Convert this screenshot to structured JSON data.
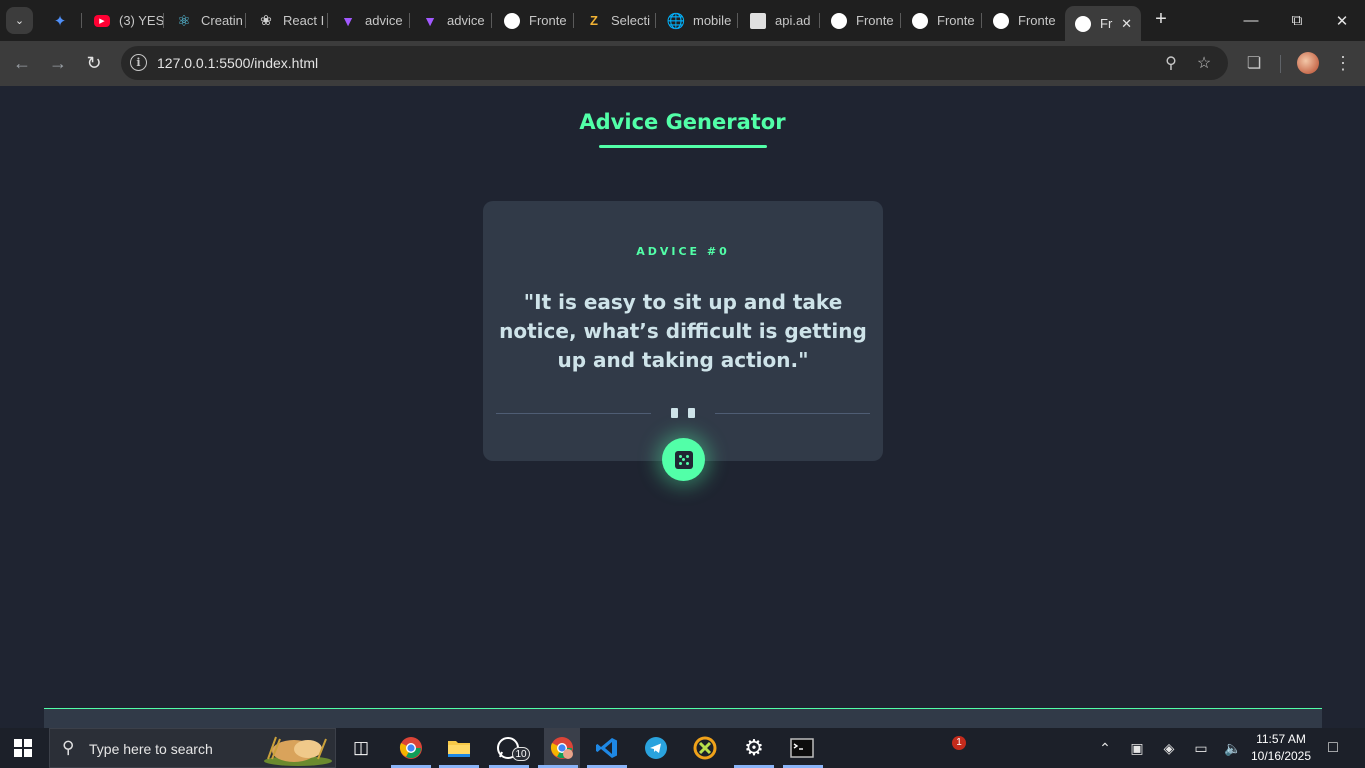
{
  "browser": {
    "tabs": [
      {
        "label": "",
        "favicon": "gemini-icon",
        "color": "#4f8ff7"
      },
      {
        "label": "(3) YES",
        "favicon": "youtube-icon",
        "color": "#ff0033"
      },
      {
        "label": "Creatin",
        "favicon": "react-icon",
        "color": "#61dafb"
      },
      {
        "label": "React I",
        "favicon": "chatgpt-icon",
        "color": "#d0d0d0"
      },
      {
        "label": "advice",
        "favicon": "vite-icon",
        "color": "#a259ff"
      },
      {
        "label": "advice",
        "favicon": "vite-icon",
        "color": "#a259ff"
      },
      {
        "label": "Fronte",
        "favicon": "frontendmentor-icon",
        "color": "#ffffff"
      },
      {
        "label": "Selecti",
        "favicon": "ziprecruiter-icon",
        "color": "#f2b233"
      },
      {
        "label": "mobile",
        "favicon": "globe-icon",
        "color": "#9aa0a6"
      },
      {
        "label": "api.ad",
        "favicon": "page-icon",
        "color": "#e0e0e0"
      },
      {
        "label": "Fronte",
        "favicon": "frontendmentor-icon",
        "color": "#ffffff"
      },
      {
        "label": "Fronte",
        "favicon": "frontendmentor-icon",
        "color": "#ffffff"
      },
      {
        "label": "Fronte",
        "favicon": "frontendmentor-icon",
        "color": "#ffffff"
      },
      {
        "label": "Fr",
        "favicon": "frontendmentor-icon",
        "color": "#ffffff",
        "active": true
      }
    ],
    "url": "127.0.0.1:5500/index.html"
  },
  "app": {
    "title": "Advice Generator",
    "advice_id": "ADVICE #0",
    "quote": "\"It is easy to sit up and take notice, what’s difficult is getting up and taking action.\"",
    "accent": "#52ffa8",
    "card_bg": "#313a48",
    "page_bg": "#1f2431",
    "text_color": "#cee3e9"
  },
  "taskbar": {
    "search_placeholder": "Type here to search",
    "apps": [
      {
        "name": "task-view-icon"
      },
      {
        "name": "chrome-icon"
      },
      {
        "name": "file-explorer-icon"
      },
      {
        "name": "whatsapp-icon",
        "badge": "10"
      },
      {
        "name": "chrome-profile-icon"
      },
      {
        "name": "vscode-icon"
      },
      {
        "name": "telegram-icon"
      },
      {
        "name": "crossover-icon"
      },
      {
        "name": "settings-icon"
      },
      {
        "name": "terminal-icon"
      }
    ],
    "notification_badge": "1",
    "time": "11:57 AM",
    "date": "10/16/2025"
  }
}
